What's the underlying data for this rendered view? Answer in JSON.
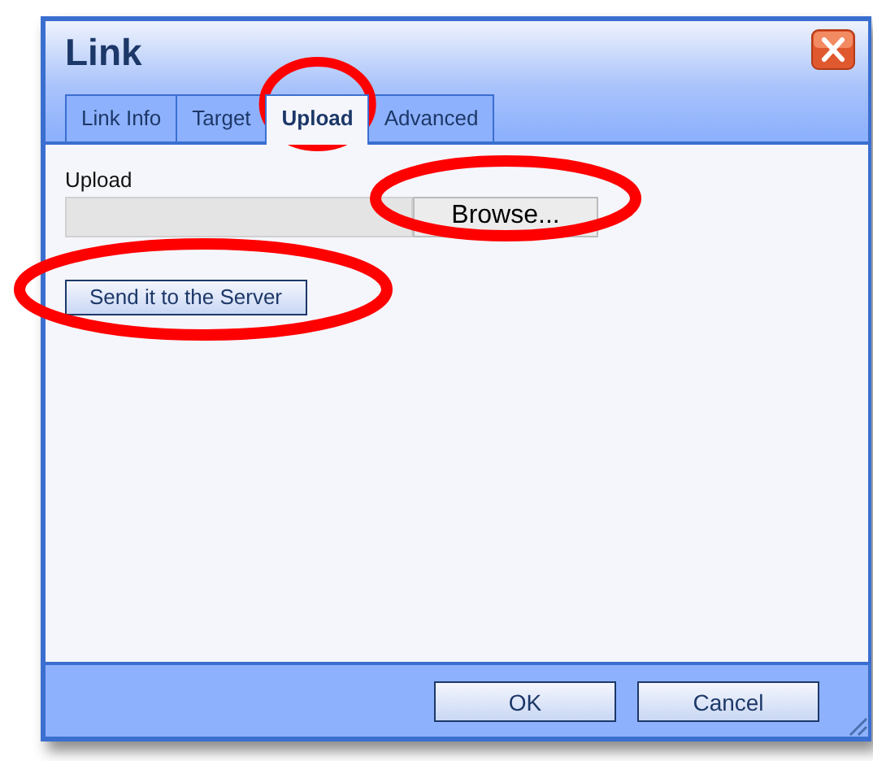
{
  "window": {
    "title": "Link"
  },
  "tabs": [
    {
      "label": "Link Info",
      "selected": false
    },
    {
      "label": "Target",
      "selected": false
    },
    {
      "label": "Upload",
      "selected": true
    },
    {
      "label": "Advanced",
      "selected": false
    }
  ],
  "upload": {
    "label": "Upload",
    "browse_button": "Browse...",
    "send_button": "Send it to the Server"
  },
  "buttons": [
    "OK",
    "Cancel"
  ]
}
